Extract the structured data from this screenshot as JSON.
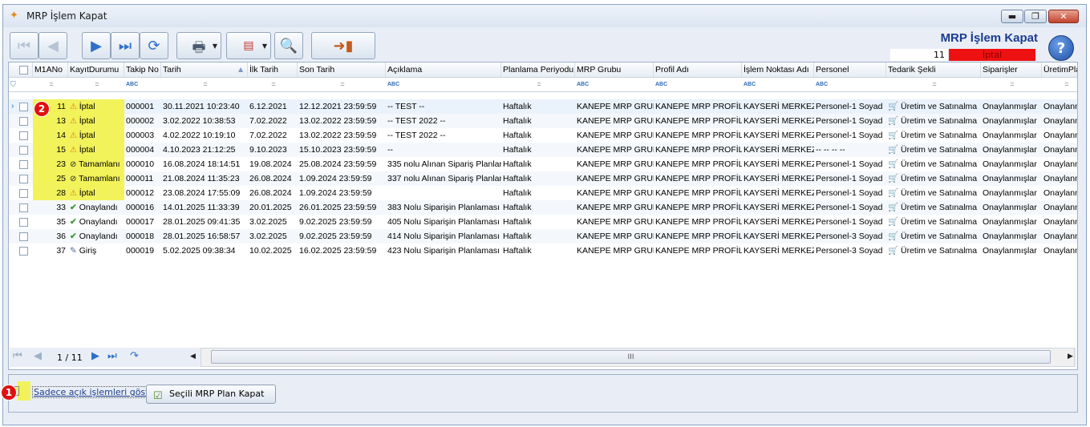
{
  "window": {
    "title": "MRP İşlem Kapat",
    "min_icon": "minimize-icon",
    "max_icon": "maximize-icon",
    "close_icon": "close-icon"
  },
  "header": {
    "title": "MRP İşlem Kapat",
    "record_no": "11",
    "status": "İptal",
    "status_color": "#ee1111",
    "help": "?"
  },
  "toolbar": {
    "icons": [
      "first-record-icon",
      "prev-record-icon",
      "next-record-icon",
      "last-record-icon",
      "refresh-icon",
      "print-icon",
      "export-pdf-icon",
      "preview-icon",
      "exit-door-icon"
    ]
  },
  "columns": [
    "",
    "M1ANo",
    "KayıtDurumu",
    "Takip No",
    "Tarih",
    "İlk Tarih",
    "Son Tarih",
    "Açıklama",
    "Planlama Periyodu",
    "MRP Grubu",
    "Profil Adı",
    "İşlem Noktası Adı",
    "Personel",
    "Tedarik Şekli",
    "Siparişler",
    "ÜretimPla"
  ],
  "filters": [
    "",
    "=",
    "=",
    "ABC",
    "=",
    "=",
    "=",
    "ABC",
    "=",
    "ABC",
    "ABC",
    "ABC",
    "ABC",
    "=",
    "=",
    "="
  ],
  "rows": [
    [
      "11",
      "İptal",
      "000001",
      "30.11.2021 10:23:40",
      "6.12.2021",
      "12.12.2021 23:59:59",
      "-- TEST --",
      "Haftalık",
      "KANEPE MRP GRUP",
      "KANEPE MRP PROFİLİ",
      "KAYSERİ MERKEZ",
      "Personel-1 Soyad",
      "Üretim ve Satınalma",
      "Onaylanmışlar",
      "Onaylanm"
    ],
    [
      "13",
      "İptal",
      "000002",
      "3.02.2022 10:38:53",
      "7.02.2022",
      "13.02.2022 23:59:59",
      "-- TEST 2022 --",
      "Haftalık",
      "KANEPE MRP GRUP",
      "KANEPE MRP PROFİLİ",
      "KAYSERİ MERKEZ",
      "Personel-1 Soyad",
      "Üretim ve Satınalma",
      "Onaylanmışlar",
      "Onaylanm"
    ],
    [
      "14",
      "İptal",
      "000003",
      "4.02.2022 10:19:10",
      "7.02.2022",
      "13.02.2022 23:59:59",
      "-- TEST 2022 --",
      "Haftalık",
      "KANEPE MRP GRUP",
      "KANEPE MRP PROFİLİ",
      "KAYSERİ MERKEZ",
      "Personel-1 Soyad",
      "Üretim ve Satınalma",
      "Onaylanmışlar",
      "Onaylanm"
    ],
    [
      "15",
      "İptal",
      "000004",
      "4.10.2023 21:12:25",
      "9.10.2023",
      "15.10.2023 23:59:59",
      "--",
      "Haftalık",
      "KANEPE MRP GRUP",
      "KANEPE MRP PROFİLİ",
      "KAYSERİ MERKEZ",
      "-- -- -- --",
      "Üretim ve Satınalma",
      "Onaylanmışlar",
      "Onaylanm"
    ],
    [
      "23",
      "Tamamlanı",
      "000010",
      "16.08.2024 18:14:51",
      "19.08.2024",
      "25.08.2024 23:59:59",
      "335 nolu Alınan Sipariş Planlar",
      "Haftalık",
      "KANEPE MRP GRUP",
      "KANEPE MRP PROFİLİ",
      "KAYSERİ MERKEZ",
      "Personel-1 Soyad",
      "Üretim ve Satınalma",
      "Onaylanmışlar",
      "Onaylanm"
    ],
    [
      "25",
      "Tamamlanı",
      "000011",
      "21.08.2024 11:35:23",
      "26.08.2024",
      "1.09.2024 23:59:59",
      "337 nolu Alınan Sipariş Planlar",
      "Haftalık",
      "KANEPE MRP GRUP",
      "KANEPE MRP PROFİLİ",
      "KAYSERİ MERKEZ",
      "Personel-1 Soyad",
      "Üretim ve Satınalma",
      "Onaylanmışlar",
      "Onaylanm"
    ],
    [
      "28",
      "İptal",
      "000012",
      "23.08.2024 17:55:09",
      "26.08.2024",
      "1.09.2024 23:59:59",
      "",
      "Haftalık",
      "KANEPE MRP GRUP",
      "KANEPE MRP PROFİLİ",
      "KAYSERİ MERKEZ",
      "Personel-1 Soyad",
      "Üretim ve Satınalma",
      "Onaylanmışlar",
      "Onaylanm"
    ],
    [
      "33",
      "Onaylandı",
      "000016",
      "14.01.2025 11:33:39",
      "20.01.2025",
      "26.01.2025 23:59:59",
      "383 Nolu Siparişin Planlaması",
      "Haftalık",
      "KANEPE MRP GRUP",
      "KANEPE MRP PROFİLİ",
      "KAYSERİ MERKEZ",
      "Personel-1 Soyad",
      "Üretim ve Satınalma",
      "Onaylanmışlar",
      "Onaylanm"
    ],
    [
      "35",
      "Onaylandı",
      "000017",
      "28.01.2025 09:41:35",
      "3.02.2025",
      "9.02.2025 23:59:59",
      "405 Nolu Siparişin Planlaması",
      "Haftalık",
      "KANEPE MRP GRUP",
      "KANEPE MRP PROFİLİ",
      "KAYSERİ MERKEZ",
      "Personel-1 Soyad",
      "Üretim ve Satınalma",
      "Onaylanmışlar",
      "Onaylanm"
    ],
    [
      "36",
      "Onaylandı",
      "000018",
      "28.01.2025 16:58:57",
      "3.02.2025",
      "9.02.2025 23:59:59",
      "414  Nolu Siparişin Planlaması",
      "Haftalık",
      "KANEPE MRP GRUP",
      "KANEPE MRP PROFİLİ",
      "KAYSERİ MERKEZ",
      "Personel-3 Soyad",
      "Üretim ve Satınalma",
      "Onaylanmışlar",
      "Onaylanm"
    ],
    [
      "37",
      "Giriş",
      "000019",
      "5.02.2025 09:38:34",
      "10.02.2025",
      "16.02.2025 23:59:59",
      "423 Nolu Siparişin Planlaması",
      "Haftalık",
      "KANEPE MRP GRUP",
      "KANEPE MRP PROFİLİ",
      "KAYSERİ MERKEZ",
      "Personel-3 Soyad",
      "Üretim ve Satınalma",
      "Onaylanmışlar",
      "Onaylanm"
    ]
  ],
  "status_icons": {
    "İptal": "warning-icon",
    "Tamamlanı": "check-circle-icon",
    "Onaylandı": "checkmark-icon",
    "Giriş": "edit-icon"
  },
  "navigator": {
    "page": "1 / 11",
    "scroll_mark": "III"
  },
  "footer": {
    "only_open_label": "Sadece açık işlemleri göster",
    "close_button_label": "Seçili MRP Plan Kapat"
  },
  "annotations": {
    "badge1": "1",
    "badge2": "2"
  },
  "highlight_color": "#f2f25a"
}
